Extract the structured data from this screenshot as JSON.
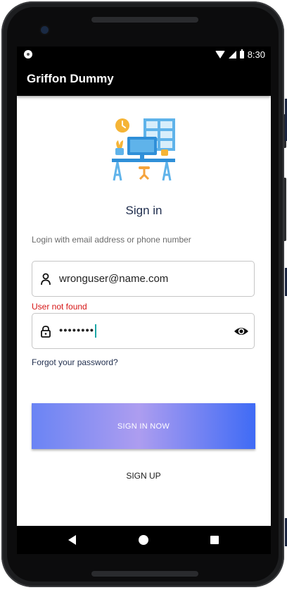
{
  "status_bar": {
    "time": "8:30",
    "icons": [
      "notification-dot-icon",
      "wifi-icon",
      "signal-icon",
      "battery-icon"
    ]
  },
  "app_bar": {
    "title": "Griffon Dummy"
  },
  "illustration": {
    "icon": "workspace-desk-illustration"
  },
  "sign_in": {
    "title": "Sign in",
    "subtitle": "Login with email address or phone number"
  },
  "email_field": {
    "value": "wronguser@name.com",
    "icon": "person-icon"
  },
  "email_error": "User not found",
  "password_field": {
    "value": "••••••••",
    "icon": "lock-icon",
    "toggle_icon": "eye-icon"
  },
  "forgot_password": "Forgot your password?",
  "buttons": {
    "sign_in_now": "SIGN IN NOW",
    "sign_up": "SIGN UP"
  },
  "colors": {
    "title": "#1f2d4d",
    "error": "#d61515",
    "button_gradient_start": "#6a84f4",
    "button_gradient_mid": "#ad9df0",
    "button_gradient_end": "#3f6bf5",
    "caret": "#1aa6a6"
  },
  "nav_bar": {
    "icons": [
      "back-icon",
      "home-icon",
      "recents-icon"
    ]
  }
}
